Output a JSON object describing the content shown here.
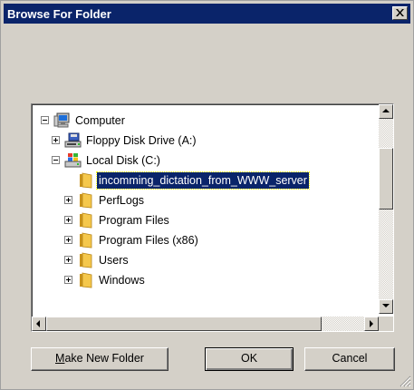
{
  "window": {
    "title": "Browse For Folder",
    "close_icon": "close-icon"
  },
  "tree": {
    "items": [
      {
        "label": "Computer",
        "icon": "computer-icon",
        "expander": "minus"
      },
      {
        "label": "Floppy Disk Drive (A:)",
        "icon": "floppy-drive-icon",
        "expander": "plus"
      },
      {
        "label": "Local Disk (C:)",
        "icon": "local-disk-icon",
        "expander": "minus"
      },
      {
        "label": "incomming_dictation_from_WWW_server",
        "icon": "folder-icon",
        "expander": "none",
        "selected": true
      },
      {
        "label": "PerfLogs",
        "icon": "folder-icon",
        "expander": "plus"
      },
      {
        "label": "Program Files",
        "icon": "folder-icon",
        "expander": "plus"
      },
      {
        "label": "Program Files (x86)",
        "icon": "folder-icon",
        "expander": "plus"
      },
      {
        "label": "Users",
        "icon": "folder-icon",
        "expander": "plus"
      },
      {
        "label": "Windows",
        "icon": "folder-icon",
        "expander": "plus"
      }
    ]
  },
  "buttons": {
    "make_new_folder_mnemonic": "M",
    "make_new_folder_rest": "ake New Folder",
    "ok": "OK",
    "cancel": "Cancel"
  },
  "colors": {
    "selection": "#0a246a",
    "face": "#d4d0c8",
    "folder": "#f5c84c"
  }
}
